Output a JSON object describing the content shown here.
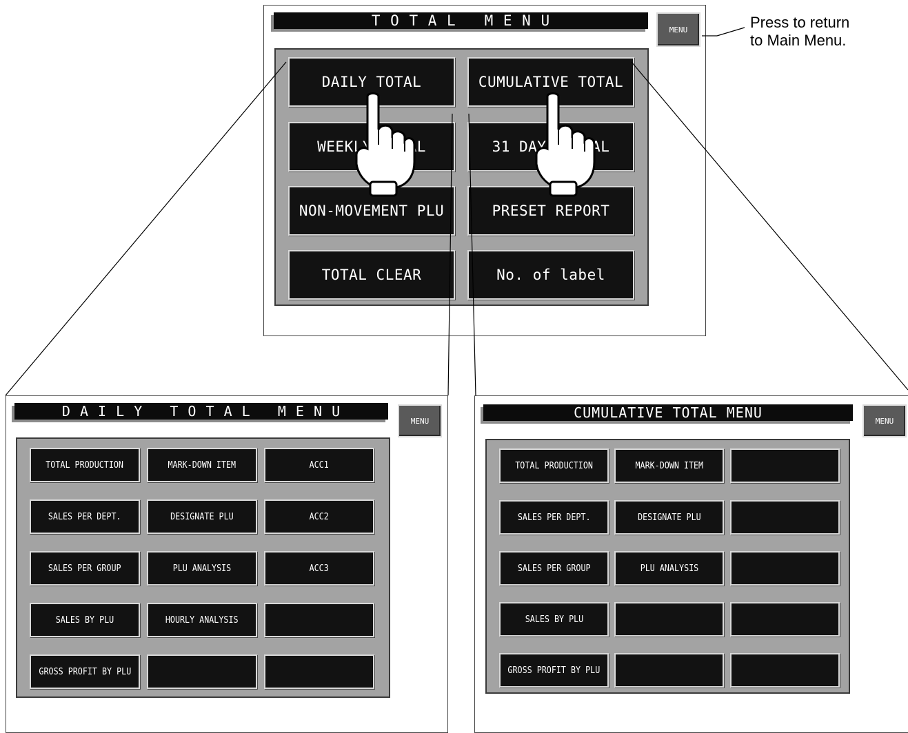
{
  "callout": {
    "line1": "Press to return",
    "line2": "to Main Menu."
  },
  "total_menu": {
    "title": "T O T A L   M E N U",
    "menu_label": "MENU",
    "buttons": [
      "DAILY TOTAL",
      "CUMULATIVE TOTAL",
      "WEEKLY TOTAL",
      "31 DAYS TOTAL",
      "NON-MOVEMENT PLU",
      "PRESET REPORT",
      "TOTAL CLEAR",
      "No. of label"
    ]
  },
  "daily_menu": {
    "title": "D A I L Y   T O T A L   M E N U",
    "menu_label": "MENU",
    "buttons": [
      "TOTAL PRODUCTION",
      "MARK-DOWN ITEM",
      "ACC1",
      "SALES PER DEPT.",
      "DESIGNATE PLU",
      "ACC2",
      "SALES PER GROUP",
      "PLU ANALYSIS",
      "ACC3",
      "SALES BY PLU",
      "HOURLY ANALYSIS",
      "",
      "GROSS PROFIT BY PLU",
      "",
      ""
    ]
  },
  "cumulative_menu": {
    "title": "CUMULATIVE TOTAL MENU",
    "menu_label": "MENU",
    "buttons": [
      "TOTAL PRODUCTION",
      "MARK-DOWN ITEM",
      "",
      "SALES PER DEPT.",
      "DESIGNATE PLU",
      "",
      "SALES PER GROUP",
      "PLU ANALYSIS",
      "",
      "SALES BY PLU",
      "",
      "",
      "GROSS PROFIT BY PLU",
      "",
      ""
    ]
  },
  "icons": [
    "pointing-hand-icon"
  ]
}
